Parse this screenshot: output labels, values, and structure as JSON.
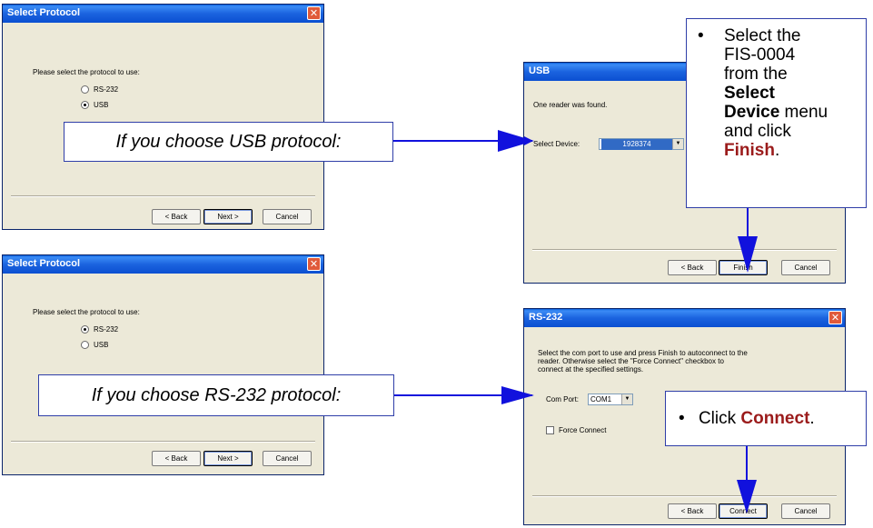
{
  "dialog_usb_select": {
    "title": "Select Protocol",
    "prompt": "Please select the protocol to use:",
    "options": [
      "RS-232",
      "USB"
    ],
    "selected": "USB",
    "back": "< Back",
    "next": "Next >",
    "cancel": "Cancel"
  },
  "dialog_rs232_select": {
    "title": "Select Protocol",
    "prompt": "Please select the protocol to use:",
    "options": [
      "RS-232",
      "USB"
    ],
    "selected": "RS-232",
    "back": "< Back",
    "next": "Next >",
    "cancel": "Cancel"
  },
  "dialog_usb": {
    "title": "USB",
    "found_text": "One reader was found.",
    "device_label": "Select Device:",
    "device_value": "1928374",
    "back": "< Back",
    "finish": "Finish",
    "cancel": "Cancel"
  },
  "dialog_rs232": {
    "title": "RS-232",
    "instructions_1": "Select the com port to use and press Finish to autoconnect to the",
    "instructions_2": "reader. Otherwise select the \"Force Connect\" checkbox to",
    "instructions_3": "connect at the specified settings.",
    "com_label": "Com Port:",
    "com_value": "COM1",
    "force_connect": "Force Connect",
    "back": "< Back",
    "connect": "Connect",
    "cancel": "Cancel"
  },
  "callouts": {
    "usb_choice": "If you choose USB protocol:",
    "rs232_choice": "If you choose RS-232 protocol:",
    "usb_step": {
      "bullet": "•",
      "line1": "Select the",
      "line2": "FIS-0004",
      "line3": "from the",
      "line4": "Select",
      "line5_bold": "Device",
      "line5_rest": " menu",
      "line6": "and click",
      "line7_red": "Finish",
      "line7_rest": "."
    },
    "rs232_step": {
      "bullet": "•",
      "prefix": "Click ",
      "red": "Connect",
      "suffix": "."
    }
  },
  "icons": {
    "close": "✕",
    "combo_arrow": "▼"
  },
  "colors": {
    "titlebar": "#0b4fd1",
    "arrow": "#1111dd",
    "highlight": "#9b1b1b",
    "selection": "#316ac5"
  }
}
